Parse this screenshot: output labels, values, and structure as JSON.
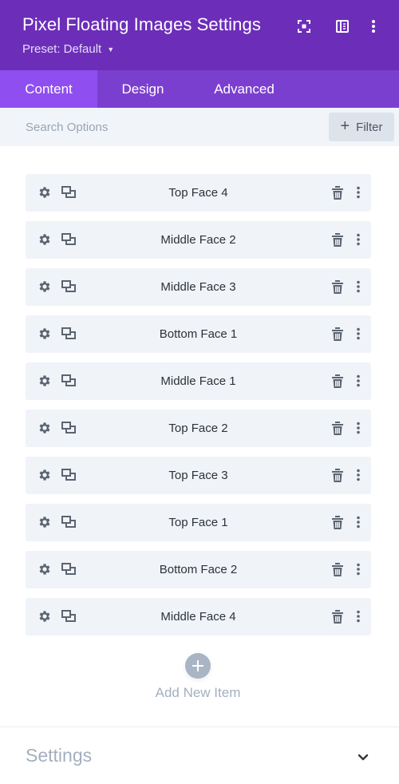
{
  "header": {
    "title": "Pixel Floating Images Settings",
    "preset_label": "Preset: Default",
    "icons": [
      "focus-icon",
      "split-view-icon",
      "more-vertical-icon"
    ],
    "bg_color": "#6c2eb9"
  },
  "tabs": [
    {
      "label": "Content",
      "active": true
    },
    {
      "label": "Design",
      "active": false
    },
    {
      "label": "Advanced",
      "active": false
    }
  ],
  "search": {
    "placeholder": "Search Options",
    "value": "",
    "filter_label": "Filter"
  },
  "items": [
    {
      "label": "Top Face 4"
    },
    {
      "label": "Middle Face 2"
    },
    {
      "label": "Middle Face 3"
    },
    {
      "label": "Bottom Face 1"
    },
    {
      "label": "Middle Face 1"
    },
    {
      "label": "Top Face 2"
    },
    {
      "label": "Top Face 3"
    },
    {
      "label": "Top Face 1"
    },
    {
      "label": "Bottom Face 2"
    },
    {
      "label": "Middle Face 4"
    }
  ],
  "add_item_label": "Add New Item",
  "settings_section": {
    "title": "Settings",
    "expanded": false
  },
  "colors": {
    "accent": "#8f4ef0",
    "tab_bar": "#7b3fcf",
    "item_bg": "#f0f3f8",
    "muted_text": "#a3afbf"
  }
}
